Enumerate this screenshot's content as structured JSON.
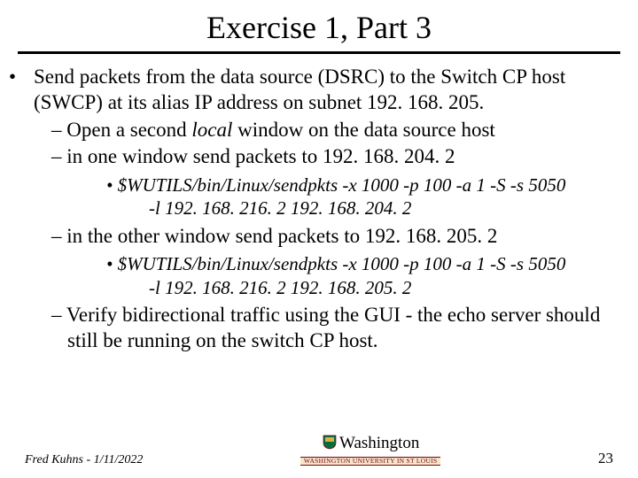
{
  "title": "Exercise 1, Part 3",
  "bullet1": "Send packets from the data source (DSRC) to the Switch CP host (SWCP) at its alias IP address on subnet 192. 168. 205.",
  "sub1": "– Open a second ",
  "sub1_italic": "local",
  "sub1_rest": " window on the data source host",
  "sub2": "– in one window send packets to 192. 168. 204. 2",
  "cmd1_line1": "$WUTILS/bin/Linux/sendpkts -x 1000 -p 100 -a 1 -S -s 5050",
  "cmd1_line2": "-l 192. 168. 216. 2 192. 168. 204. 2",
  "sub3": "– in the other window send packets to 192. 168. 205. 2",
  "cmd2_line1": "$WUTILS/bin/Linux/sendpkts -x 1000 -p 100 -a 1 -S -s 5050",
  "cmd2_line2": "-l 192. 168. 216. 2 192. 168. 205. 2",
  "sub4": "– Verify bidirectional traffic using the GUI - the echo server should still be running on the switch CP host.",
  "footer_left": "Fred Kuhns - 1/11/2022",
  "footer_center_main": "Washington",
  "footer_center_sub": "WASHINGTON UNIVERSITY IN ST LOUIS",
  "footer_right": "23"
}
